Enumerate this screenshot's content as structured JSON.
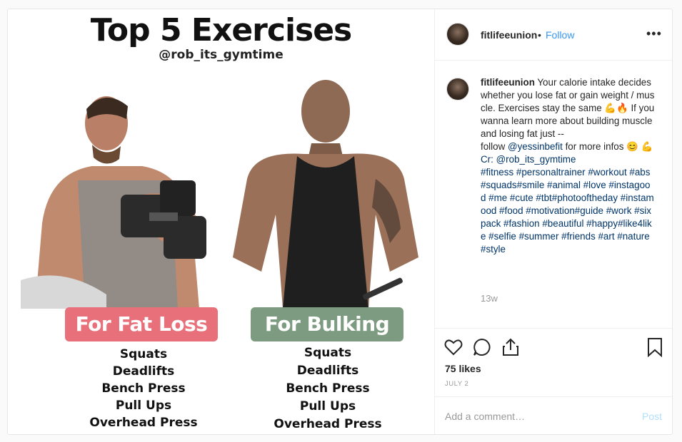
{
  "image": {
    "title": "Top 5 Exercises",
    "handle": "@rob_its_gymtime",
    "left_tag": "For Fat Loss",
    "right_tag": "For Bulking",
    "left_list": [
      "Squats",
      "Deadlifts",
      "Bench Press",
      "Pull Ups",
      "Overhead Press"
    ],
    "right_list": [
      "Squats",
      "Deadlifts",
      "Bench Press",
      "Pull Ups",
      "Overhead Press"
    ],
    "colors": {
      "fat_tag": "#e8707a",
      "bulk_tag": "#7d9b80"
    }
  },
  "header": {
    "username": "fitlifeeunion",
    "dot": "•",
    "follow_label": "Follow",
    "more_icon": "more-horizontal-icon"
  },
  "caption": {
    "username": "fitlifeeunion",
    "text_1": "Your calorie intake decides whether you lose fat or gain weight / muscle. Exercises stay the same 💪🔥 If you wanna learn more about building muscle and losing fat just --",
    "text_2": "follow",
    "mention": "@yessinbefit",
    "text_3": " for more infos 😊 💪",
    "credit": "Cr: @rob_its_gymtime",
    "hashtags": "#fitness #personaltrainer #workout #abs #squads#smile #animal #love #instagood #me #cute #tbt#photooftheday #instamood #food #motivation#guide #work #sixpack #fashion #beautiful #happy#like4like #selfie #summer #friends #art #nature#style",
    "time": "13w"
  },
  "actions": {
    "icons": [
      "heart-icon",
      "comment-icon",
      "share-icon",
      "bookmark-icon"
    ]
  },
  "likes": "75 likes",
  "date": "JULY 2",
  "comment_box": {
    "placeholder": "Add a comment…",
    "post_label": "Post"
  },
  "colors": {
    "link": "#3897f0",
    "muted": "#999999"
  }
}
